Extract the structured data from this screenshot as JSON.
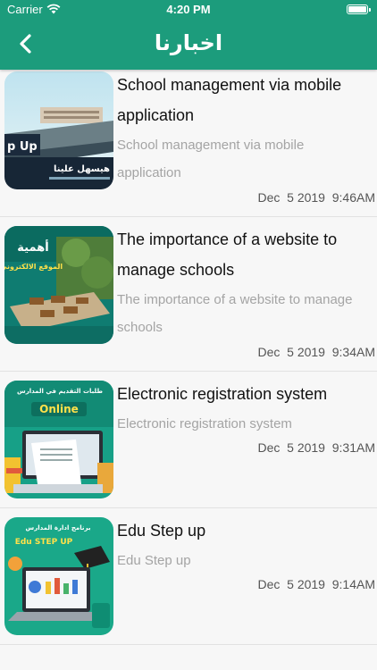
{
  "status_bar": {
    "carrier": "Carrier",
    "time": "4:20 PM"
  },
  "nav": {
    "title": "اخبارنا",
    "back_icon": "chevron-left-icon"
  },
  "colors": {
    "header": "#1c9c7c",
    "title_text": "#111111",
    "subtitle_text": "#a4a4a4"
  },
  "news": [
    {
      "title": "School management via mobile application",
      "subtitle": "School management via mobile application",
      "date": "Dec  5 2019  9:46AM",
      "thumb_text_1": "p Up",
      "thumb_text_2": "هيسهل علينا"
    },
    {
      "title": "The importance of a website to manage schools",
      "subtitle": "The importance of a website to manage schools",
      "date": "Dec  5 2019  9:34AM",
      "thumb_text_1": "أهمية",
      "thumb_text_2": "الموقع الالكتروني"
    },
    {
      "title": "Electronic registration system",
      "subtitle": "Electronic registration system",
      "date": "Dec  5 2019  9:31AM",
      "thumb_text_1": "طلبات التقديم في المدارس",
      "thumb_text_2": "Online"
    },
    {
      "title": "Edu Step up",
      "subtitle": "Edu Step up",
      "date": "Dec  5 2019  9:14AM",
      "thumb_text_1": "برنامج ادارة المدارس",
      "thumb_text_2": "Edu STEP UP"
    }
  ]
}
